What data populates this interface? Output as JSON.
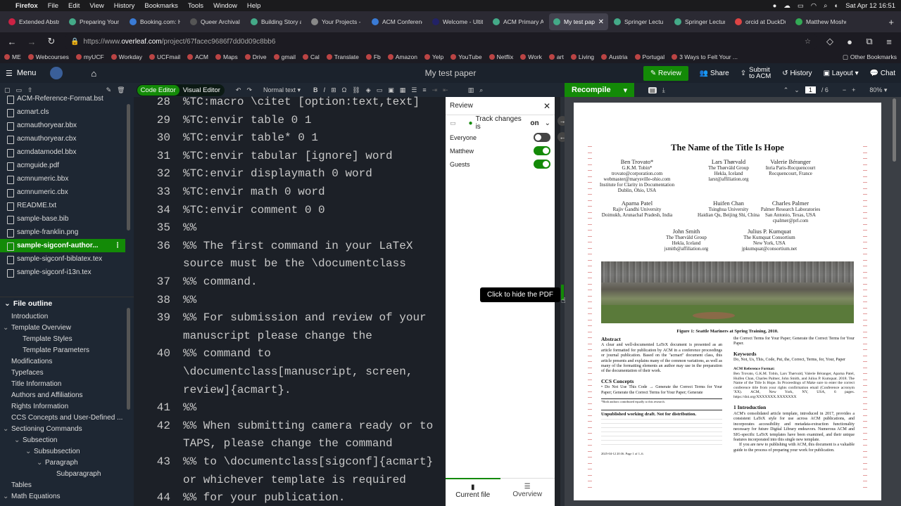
{
  "mac_menu": {
    "apple": "",
    "app": "Firefox",
    "items": [
      "File",
      "Edit",
      "View",
      "History",
      "Bookmarks",
      "Tools",
      "Window",
      "Help"
    ],
    "clock": "Sat Apr 12  16:51"
  },
  "tabs": [
    "Extended Abstr",
    "Preparing Your",
    "Booking.com: H",
    "Queer Archival I",
    "Building Story a",
    "Your Projects - (",
    "ACM Conferenc",
    "Welcome - Ultit",
    "ACM Primary Ar",
    "My test paper",
    "Springer Lectu",
    "Springer Lectur",
    "orcid at DuckDu",
    "Matthew Moshe"
  ],
  "active_tab": 9,
  "url": {
    "prefix": "https://www.",
    "domain": "overleaf.com",
    "path": "/project/67facec9686f7dd0d09c8bb6"
  },
  "bookmarks": [
    "ME",
    "Webcourses",
    "myUCF",
    "Workday",
    "UCFmail",
    "ACM",
    "Maps",
    "Drive",
    "gmail",
    "Cal",
    "Translate",
    "Fb",
    "Amazon",
    "Yelp",
    "YouTube",
    "Netflix",
    "Work",
    "art",
    "Living",
    "Austria",
    "Portugal",
    "3 Ways to Felt Your ..."
  ],
  "other_bookmarks": "Other Bookmarks",
  "overleaf": {
    "menu": "Menu",
    "title": "My test paper",
    "review": "Review",
    "share": "Share",
    "submit_line1": "Submit",
    "submit_line2": "to ACM",
    "history": "History",
    "layout": "Layout",
    "chat": "Chat"
  },
  "toolbar": {
    "code_editor": "Code Editor",
    "visual_editor": "Visual Editor",
    "text_style": "Normal text",
    "recompile": "Recompile",
    "page": "1",
    "page_total": "/ 6",
    "zoom": "80%"
  },
  "files": [
    "ACM-Reference-Format.bst",
    "acmart.cls",
    "acmauthoryear.bbx",
    "acmauthoryear.cbx",
    "acmdatamodel.bbx",
    "acmguide.pdf",
    "acmnumeric.bbx",
    "acmnumeric.cbx",
    "README.txt",
    "sample-base.bib",
    "sample-franklin.png",
    "sample-sigconf-author...",
    "sample-sigconf-biblatex.tex",
    "sample-sigconf-i13n.tex"
  ],
  "selected_file": 11,
  "outline_header": "File outline",
  "outline": [
    {
      "t": "Introduction",
      "lvl": 0
    },
    {
      "t": "Template Overview",
      "lvl": 0,
      "exp": true
    },
    {
      "t": "Template Styles",
      "lvl": 1
    },
    {
      "t": "Template Parameters",
      "lvl": 1
    },
    {
      "t": "Modifications",
      "lvl": 0
    },
    {
      "t": "Typefaces",
      "lvl": 0
    },
    {
      "t": "Title Information",
      "lvl": 0
    },
    {
      "t": "Authors and Affiliations",
      "lvl": 0
    },
    {
      "t": "Rights Information",
      "lvl": 0
    },
    {
      "t": "CCS Concepts and User-Defined ...",
      "lvl": 0
    },
    {
      "t": "Sectioning Commands",
      "lvl": 0,
      "exp": true
    },
    {
      "t": "Subsection",
      "lvl": 1,
      "exp": true
    },
    {
      "t": "Subsubsection",
      "lvl": 2,
      "exp": true
    },
    {
      "t": "Paragraph",
      "lvl": 3,
      "exp": true
    },
    {
      "t": "Subparagraph",
      "lvl": 4
    },
    {
      "t": "Tables",
      "lvl": 0
    },
    {
      "t": "Math Equations",
      "lvl": 0,
      "exp": true
    }
  ],
  "code": [
    {
      "n": "28",
      "l": [
        "%TC:macro \\citet [option:text,text]"
      ]
    },
    {
      "n": "29",
      "l": [
        "%TC:envir table 0 1"
      ]
    },
    {
      "n": "30",
      "l": [
        "%TC:envir table* 0 1"
      ]
    },
    {
      "n": "31",
      "l": [
        "%TC:envir tabular [ignore] word"
      ]
    },
    {
      "n": "32",
      "l": [
        "%TC:envir displaymath 0 word"
      ]
    },
    {
      "n": "33",
      "l": [
        "%TC:envir math 0 word"
      ]
    },
    {
      "n": "34",
      "l": [
        "%TC:envir comment 0 0"
      ]
    },
    {
      "n": "35",
      "l": [
        "%%"
      ]
    },
    {
      "n": "36",
      "l": [
        "%% The first command in your LaTeX",
        "source must be the \\documentclass"
      ]
    },
    {
      "n": "37",
      "l": [
        "%% command."
      ]
    },
    {
      "n": "38",
      "l": [
        "%%"
      ]
    },
    {
      "n": "39",
      "l": [
        "%% For submission and review of your",
        "manuscript please change the"
      ]
    },
    {
      "n": "40",
      "l": [
        "%% command to",
        "\\documentclass[manuscript, screen,",
        "review]{acmart}."
      ]
    },
    {
      "n": "41",
      "l": [
        "%%"
      ]
    },
    {
      "n": "42",
      "l": [
        "%% When submitting camera ready or to",
        "TAPS, please change the command"
      ]
    },
    {
      "n": "43",
      "l": [
        "%% to \\documentclass[sigconf]{acmart}",
        "or whichever template is required"
      ]
    },
    {
      "n": "44",
      "l": [
        "%% for your publication."
      ]
    }
  ],
  "review_panel": {
    "title": "Review",
    "track": "Track changes is",
    "track_state": "on",
    "rows": [
      {
        "label": "Everyone",
        "on": false
      },
      {
        "label": "Matthew",
        "on": true
      },
      {
        "label": "Guests",
        "on": true
      }
    ],
    "tab_current": "Current file",
    "tab_overview": "Overview"
  },
  "tooltip": "Click to hide the PDF",
  "pdf": {
    "title": "The Name of the Title Is Hope",
    "authors": [
      {
        "name": "Ben Trovato*",
        "lines": [
          "G.K.M. Tobin*",
          "trovato@corporation.com",
          "webmaster@marysville-ohio.com",
          "Institute for Clarity in Documentation",
          "Dublin, Ohio, USA"
        ]
      },
      {
        "name": "Lars Thørvald",
        "lines": [
          "The Thørväld Group",
          "Hekla, Iceland",
          "larst@affiliation.org"
        ]
      },
      {
        "name": "Valerie Béranger",
        "lines": [
          "Inria Paris-Rocquencourt",
          "Rocquencourt, France"
        ]
      },
      {
        "name": "Aparna Patel",
        "lines": [
          "Rajiv Gandhi University",
          "Doimukh, Arunachal Pradesh, India"
        ]
      },
      {
        "name": "Huifen Chan",
        "lines": [
          "Tsinghua University",
          "Haidian Qu, Beijing Shi, China"
        ]
      },
      {
        "name": "Charles Palmer",
        "lines": [
          "Palmer Research Laboratories",
          "San Antonio, Texas, USA",
          "cpalmer@prl.com"
        ]
      },
      {
        "name": "John Smith",
        "lines": [
          "The Thørväld Group",
          "Hekla, Iceland",
          "jsmith@affiliation.org"
        ]
      },
      {
        "name": "Julius P. Kumquat",
        "lines": [
          "The Kumquat Consortium",
          "New York, USA",
          "jpkumquat@consortium.net"
        ]
      }
    ],
    "figure_caption": "Figure 1: Seattle Mariners at Spring Training, 2010.",
    "abstract_h": "Abstract",
    "abstract": "A clear and well-documented LaTeX document is presented as an article formatted for publication by ACM in a conference proceedings or journal publication. Based on the \"acmart\" document class, this article presents and explains many of the common variations, as well as many of the formatting elements an author may use in the preparation of the documentation of their work.",
    "ccs_h": "CCS Concepts",
    "ccs": "• Do Not Use This Code → Generate the Correct Terms for Your Paper; Generate the Correct Terms for Your Paper; Generate",
    "footnote": "*Both authors contributed equally to this research.",
    "unpublished": "Unpublished working draft. Not for distribution.",
    "date_line": "2025-04-12 20:36. Page 1 of 1–6.",
    "right_top": "the Correct Terms for Your Paper; Generate the Correct Terms for Your Paper.",
    "keywords_h": "Keywords",
    "keywords": "Do, Not, Us, This, Code, Put, the, Correct, Terms, for, Your, Paper",
    "ref_h": "ACM Reference Format:",
    "ref": "Ben Trovato, G.K.M. Tobin, Lars Thørvald, Valerie Béranger, Aparna Patel, Huifen Chan, Charles Palmer, John Smith, and Julius P. Kumquat. 2018. The Name of the Title Is Hope. In Proceedings of Make sure to enter the correct conference title from your rights confirmation email (Conference acronym 'XX). ACM, New York, NY, USA, 6 pages. https://doi.org/XXXXXXX.XXXXXXX",
    "intro_h": "1   Introduction",
    "intro": "ACM's consolidated article template, introduced in 2017, provides a consistent LaTeX style for use across ACM publications, and incorporates accessibility and metadata-extraction functionality necessary for future Digital Library endeavors. Numerous ACM and SIG-specific LaTeX templates have been examined, and their unique features incorporated into this single new template.",
    "intro2": "If you are new to publishing with ACM, this document is a valuable guide to the process of preparing your work for publication."
  },
  "colors": {
    "accent": "#138a07",
    "editor_bg": "#1c2027",
    "sidebar_bg": "#1e2733"
  }
}
